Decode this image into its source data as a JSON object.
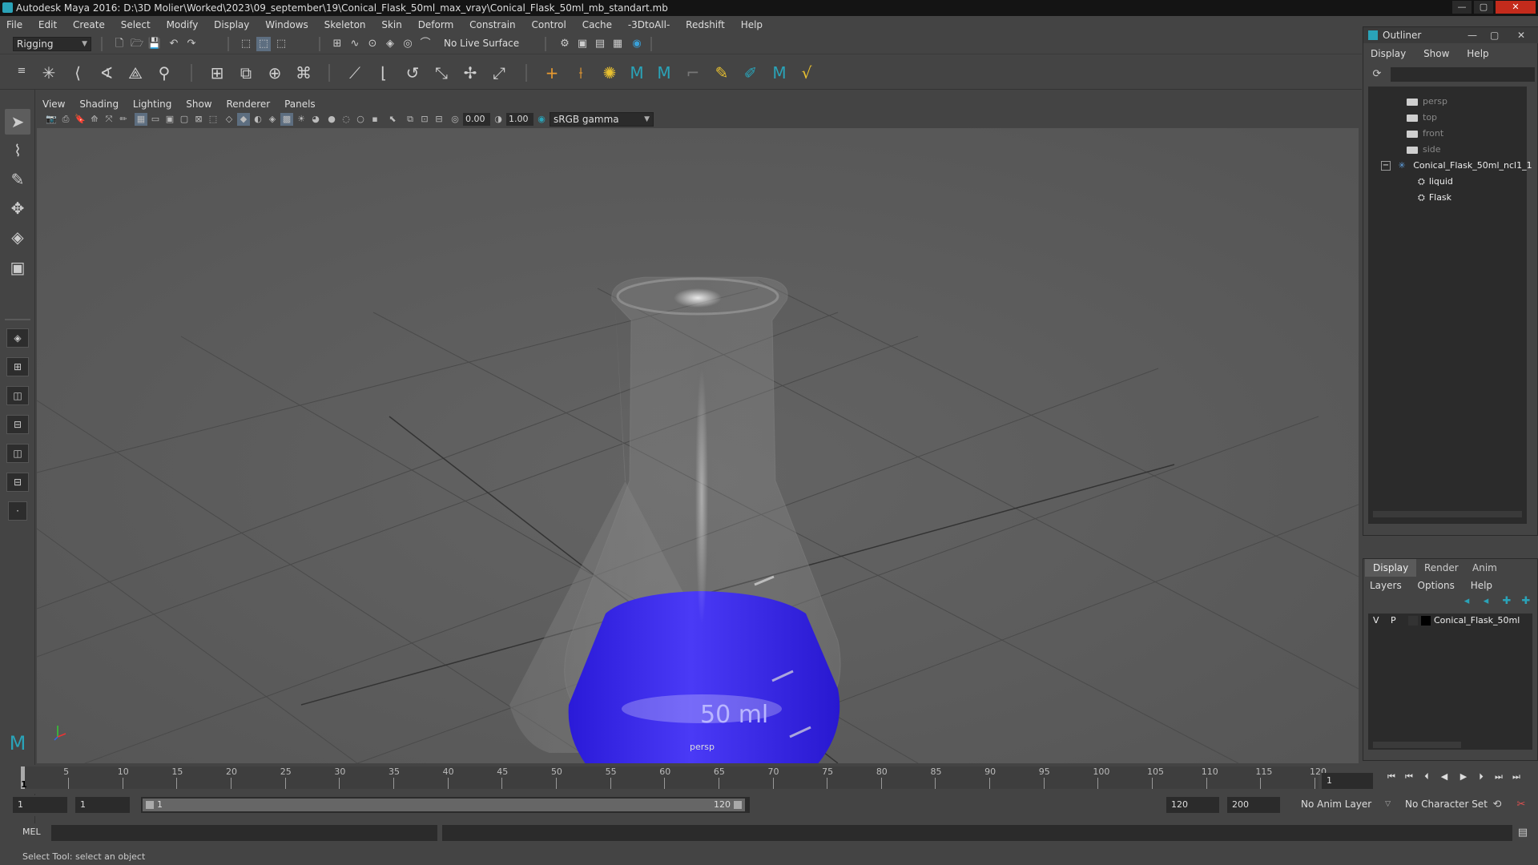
{
  "window": {
    "title": "Autodesk Maya 2016: D:\\3D Molier\\Worked\\2023\\09_september\\19\\Conical_Flask_50ml_max_vray\\Conical_Flask_50ml_mb_standart.mb"
  },
  "menubar": [
    "File",
    "Edit",
    "Create",
    "Select",
    "Modify",
    "Display",
    "Windows",
    "Skeleton",
    "Skin",
    "Deform",
    "Constrain",
    "Control",
    "Cache",
    "-3DtoAll-",
    "Redshift",
    "Help"
  ],
  "statusline": {
    "menuset": "Rigging",
    "live_surface": "No Live Surface"
  },
  "viewport": {
    "menu": [
      "View",
      "Shading",
      "Lighting",
      "Show",
      "Renderer",
      "Panels"
    ],
    "exposure": "0.00",
    "gamma": "1.00",
    "color_space": "sRGB gamma",
    "camera_label": "persp",
    "flask_label": "50 ml"
  },
  "outliner": {
    "title": "Outliner",
    "menu": [
      "Display",
      "Show",
      "Help"
    ],
    "items": [
      {
        "label": "persp",
        "kind": "camera"
      },
      {
        "label": "top",
        "kind": "camera"
      },
      {
        "label": "front",
        "kind": "camera"
      },
      {
        "label": "side",
        "kind": "camera"
      },
      {
        "label": "Conical_Flask_50ml_ncl1_1",
        "kind": "group"
      },
      {
        "label": "liquid",
        "kind": "mesh"
      },
      {
        "label": "Flask",
        "kind": "mesh"
      }
    ]
  },
  "layer_editor": {
    "tabs": [
      "Display",
      "Render",
      "Anim"
    ],
    "active_tab": "Display",
    "menu": [
      "Layers",
      "Options",
      "Help"
    ],
    "layer": {
      "visible": "V",
      "playback": "P",
      "name": "Conical_Flask_50ml"
    }
  },
  "timeline": {
    "ticks": [
      "5",
      "10",
      "15",
      "20",
      "25",
      "30",
      "35",
      "40",
      "45",
      "50",
      "55",
      "60",
      "65",
      "70",
      "75",
      "80",
      "85",
      "90",
      "95",
      "100",
      "105",
      "110",
      "115",
      "120"
    ],
    "current_frame_marker": "1",
    "current_frame": "1"
  },
  "range": {
    "start": "1",
    "playback_start": "1",
    "slider_start": "1",
    "slider_end": "120",
    "playback_end": "120",
    "end": "200",
    "anim_layer": "No Anim Layer",
    "character_set": "No Character Set"
  },
  "command_line": {
    "label": "MEL"
  },
  "help_line": "Select Tool: select an object",
  "colors": {
    "liquid": "#3f2df0",
    "background": "#5d5d5d",
    "accent": "#2aa3b8"
  }
}
